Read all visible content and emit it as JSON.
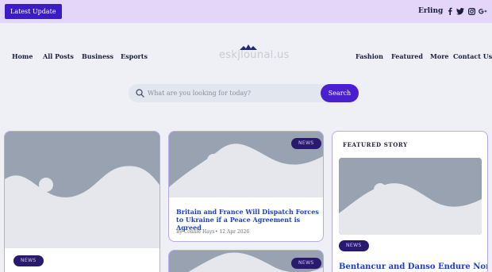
{
  "topbar": {
    "latest_label": "Latest Update",
    "word": "Erling",
    "social": [
      {
        "icon": "facebook-icon",
        "glyph": "f"
      },
      {
        "icon": "twitter-icon",
        "glyph": "t"
      },
      {
        "icon": "instagram-icon",
        "glyph": "ig"
      },
      {
        "icon": "google-plus-icon",
        "glyph": "g+"
      }
    ]
  },
  "nav": {
    "left": [
      "Home",
      "All Posts",
      "Business",
      "Esports"
    ],
    "right": [
      "Fashion",
      "Featured",
      "More",
      "Contact Us"
    ]
  },
  "logo": {
    "text": "eskjlounal.us"
  },
  "search": {
    "placeholder": "What are you looking for today?",
    "button_label": "Search"
  },
  "cards": {
    "card1": {
      "badge": "NEWS"
    },
    "card2": {
      "badge": "NEWS",
      "title": "Britain and France Will Dispatch Forces to Ukraine if a Peace Agreement is Agreed",
      "author": "By Connie Hays",
      "date": "12 Apr 2026"
    },
    "card3": {
      "badge": "NEWS"
    }
  },
  "featured": {
    "label": "FEATURED STORY",
    "badge": "NEWS",
    "title": "Bentancur and Danso Endure North"
  },
  "colors": {
    "accent": "#4a1fd0",
    "topbar": "#e3d6f9",
    "link": "#1d3fd0"
  }
}
